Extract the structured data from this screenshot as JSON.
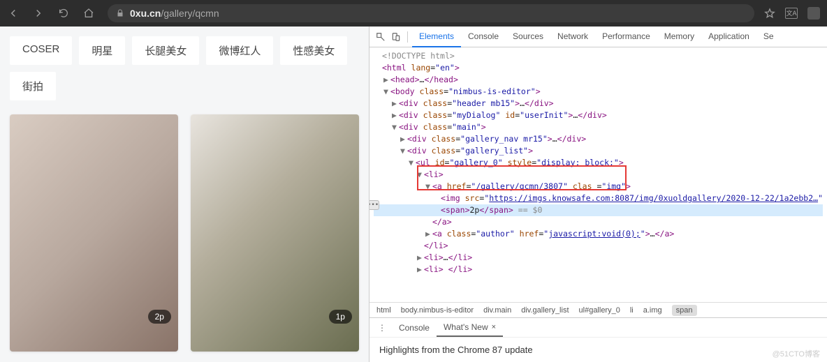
{
  "browser": {
    "url_host": "0xu.cn",
    "url_path": "/gallery/qcmn"
  },
  "page": {
    "tags": [
      "COSER",
      "明星",
      "长腿美女",
      "微博红人",
      "性感美女",
      "街拍"
    ],
    "gallery": [
      {
        "badge": "2p"
      },
      {
        "badge": "1p"
      }
    ]
  },
  "devtools": {
    "tabs": [
      "Elements",
      "Console",
      "Sources",
      "Network",
      "Performance",
      "Memory",
      "Application",
      "Se"
    ],
    "active_tab": "Elements",
    "dom_lines": [
      {
        "indent": 0,
        "html": "<span class='grey'>&lt;!DOCTYPE html&gt;</span>"
      },
      {
        "indent": 0,
        "html": "<span class='t'>&lt;html</span> <span class='a'>lang</span>=<span class='v'>\"en\"</span><span class='t'>&gt;</span>"
      },
      {
        "indent": 1,
        "tri": "▶",
        "html": "<span class='t'>&lt;head&gt;</span>…<span class='t'>&lt;/head&gt;</span>"
      },
      {
        "indent": 1,
        "tri": "▼",
        "html": "<span class='t'>&lt;body</span> <span class='a'>class</span>=<span class='v'>\"nimbus-is-editor\"</span><span class='t'>&gt;</span>"
      },
      {
        "indent": 2,
        "tri": "▶",
        "html": "<span class='t'>&lt;div</span> <span class='a'>class</span>=<span class='v'>\"header mb15\"</span><span class='t'>&gt;</span>…<span class='t'>&lt;/div&gt;</span>"
      },
      {
        "indent": 2,
        "tri": "▶",
        "html": "<span class='t'>&lt;div</span> <span class='a'>class</span>=<span class='v'>\"myDialog\"</span> <span class='a'>id</span>=<span class='v'>\"userInit\"</span><span class='t'>&gt;</span>…<span class='t'>&lt;/div&gt;</span>"
      },
      {
        "indent": 2,
        "tri": "▼",
        "html": "<span class='t'>&lt;div</span> <span class='a'>class</span>=<span class='v'>\"main\"</span><span class='t'>&gt;</span>"
      },
      {
        "indent": 3,
        "tri": "▶",
        "html": "<span class='t'>&lt;div</span> <span class='a'>class</span>=<span class='v'>\"gallery_nav mr15\"</span><span class='t'>&gt;</span>…<span class='t'>&lt;/div&gt;</span>"
      },
      {
        "indent": 3,
        "tri": "▼",
        "html": "<span class='t'>&lt;div</span> <span class='a'>class</span>=<span class='v'>\"gallery_list\"</span><span class='t'>&gt;</span>"
      },
      {
        "indent": 4,
        "tri": "▼",
        "html": "<span class='t'>&lt;ul</span> <span class='a'>id</span>=<span class='v'>\"gallery_0\"</span> <span class='a'>style</span>=<span class='v'>\"display: block;\"</span><span class='t'>&gt;</span>"
      },
      {
        "indent": 5,
        "tri": "▼",
        "html": "<span class='t'>&lt;li&gt;</span>"
      },
      {
        "indent": 6,
        "tri": "▼",
        "html": "<span class='t'>&lt;a</span> <span class='a'>href</span>=<span class='v'>\"<a>/gallery/qcmn/3807</a>\"</span> <span class='a'>clas</span> =<span class='v'>\"img\"</span><span class='t'>&gt;</span>"
      },
      {
        "indent": 7,
        "html": "<span class='t'>&lt;img</span> <span class='a'>src</span>=<span class='v'>\"<a>https://imgs.knowsafe.com:8087/img/0xuoldgallery/2020-12-22/1a2ebb2…</a>\"</span>"
      },
      {
        "indent": 7,
        "hl": true,
        "html": "<span class='t'>&lt;span&gt;</span>2p<span class='t'>&lt;/span&gt;</span> <span class='grey'>== $0</span>"
      },
      {
        "indent": 6,
        "html": "<span class='t'>&lt;/a&gt;</span>"
      },
      {
        "indent": 6,
        "tri": "▶",
        "html": "<span class='t'>&lt;a</span> <span class='a'>class</span>=<span class='v'>\"author\"</span> <span class='a'>href</span>=<span class='v'>\"<a>javascript:void(0);</a>\"</span><span class='t'>&gt;</span>…<span class='t'>&lt;/a&gt;</span>"
      },
      {
        "indent": 5,
        "html": "<span class='t'>&lt;/li&gt;</span>"
      },
      {
        "indent": 5,
        "tri": "▶",
        "html": "<span class='t'>&lt;li&gt;</span>…<span class='t'>&lt;/li&gt;</span>"
      },
      {
        "indent": 5,
        "tri": "▶",
        "html": "<span class='t'>&lt;li&gt;</span> <span class='t'>&lt;/li&gt;</span>"
      }
    ],
    "breadcrumbs": [
      "html",
      "body.nimbus-is-editor",
      "div.main",
      "div.gallery_list",
      "ul#gallery_0",
      "li",
      "a.img",
      "span"
    ],
    "drawer_tabs": [
      {
        "label": "Console",
        "closable": false
      },
      {
        "label": "What's New",
        "closable": true
      }
    ],
    "drawer_active": "What's New",
    "drawer_headline": "Highlights from the Chrome 87 update"
  },
  "watermark": "@51CTO博客"
}
